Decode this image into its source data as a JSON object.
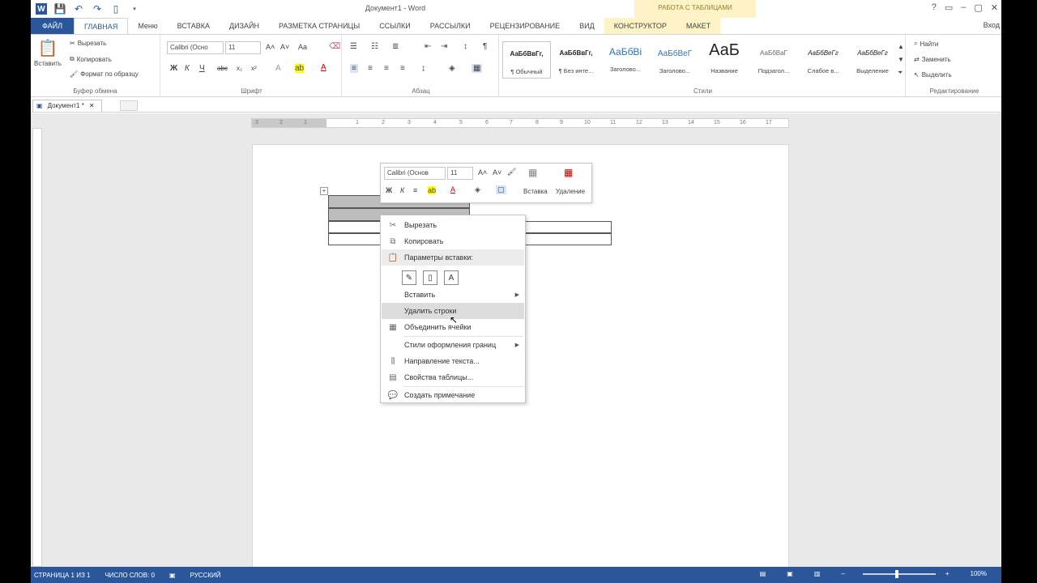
{
  "window": {
    "title": "Документ1 - Word",
    "context_header": "РАБОТА С ТАБЛИЦАМИ",
    "controls": [
      "?",
      "▭",
      "–",
      "▢",
      "✕"
    ]
  },
  "tabs": [
    "ФАЙЛ",
    "ГЛАВНАЯ",
    "Меню",
    "ВСТАВКА",
    "ДИЗАЙН",
    "РАЗМЕТКА СТРАНИЦЫ",
    "ССЫЛКИ",
    "РАССЫЛКИ",
    "РЕЦЕНЗИРОВАНИЕ",
    "ВИД",
    "КОНСТРУКТОР",
    "МАКЕТ"
  ],
  "login": "Вход",
  "ribbon": {
    "clipboard": {
      "paste": "Вставить",
      "cut": "Вырезать",
      "copy": "Копировать",
      "format_painter": "Формат по образцу",
      "label": "Буфер обмена"
    },
    "font": {
      "name": "Calibri (Осно",
      "size": "11",
      "label": "Шрифт",
      "bold": "Ж",
      "italic": "К",
      "underline": "Ч",
      "strike": "abc",
      "sub": "x₂",
      "sup": "x²",
      "grow": "A˄",
      "shrink": "A˅",
      "case": "Aa",
      "text_color": "A"
    },
    "paragraph": {
      "label": "Абзац"
    },
    "styles": {
      "label": "Стили",
      "items": [
        {
          "sample": "АаБбВвГг,",
          "name": "¶ Обычный"
        },
        {
          "sample": "АаБбВвГг,",
          "name": "¶ Без инте..."
        },
        {
          "sample": "АаБбВі",
          "name": "Заголово..."
        },
        {
          "sample": "АаБбВеГ",
          "name": "Заголово..."
        },
        {
          "sample": "АаБ",
          "name": "Название"
        },
        {
          "sample": "АаБбВаГ",
          "name": "Подзагол..."
        },
        {
          "sample": "АаБбВеГг",
          "name": "Слабое в..."
        },
        {
          "sample": "АаБбВеГг",
          "name": "Выделение"
        }
      ]
    },
    "editing": {
      "find": "Найти",
      "replace": "Заменить",
      "select": "Выделить",
      "label": "Редактирование"
    }
  },
  "doc_tab": {
    "name": "Документ1 *",
    "close": "✕"
  },
  "ruler": [
    "3",
    "2",
    "1",
    "1",
    "2",
    "3",
    "4",
    "5",
    "6",
    "7",
    "8",
    "9",
    "10",
    "11",
    "12",
    "13",
    "14",
    "15",
    "16",
    "17"
  ],
  "minibar": {
    "font": "Calibri (Основ",
    "size": "11",
    "bold": "Ж",
    "italic": "К",
    "insert": "Вставка",
    "delete": "Удаление"
  },
  "context_menu": {
    "cut": "Вырезать",
    "copy": "Копировать",
    "paste_options": "Параметры вставки:",
    "insert": "Вставить",
    "delete_rows": "Удалить строки",
    "merge_cells": "Объединить ячейки",
    "border_styles": "Стили оформления границ",
    "text_direction": "Направление текста...",
    "table_properties": "Свойства таблицы...",
    "new_comment": "Создать примечание"
  },
  "status": {
    "page": "СТРАНИЦА 1 ИЗ 1",
    "words": "ЧИСЛО СЛОВ: 0",
    "lang": "РУССКИЙ",
    "zoom": "100%"
  },
  "colors": {
    "word_blue": "#2b579a",
    "context_tab": "#fdf3c7"
  }
}
